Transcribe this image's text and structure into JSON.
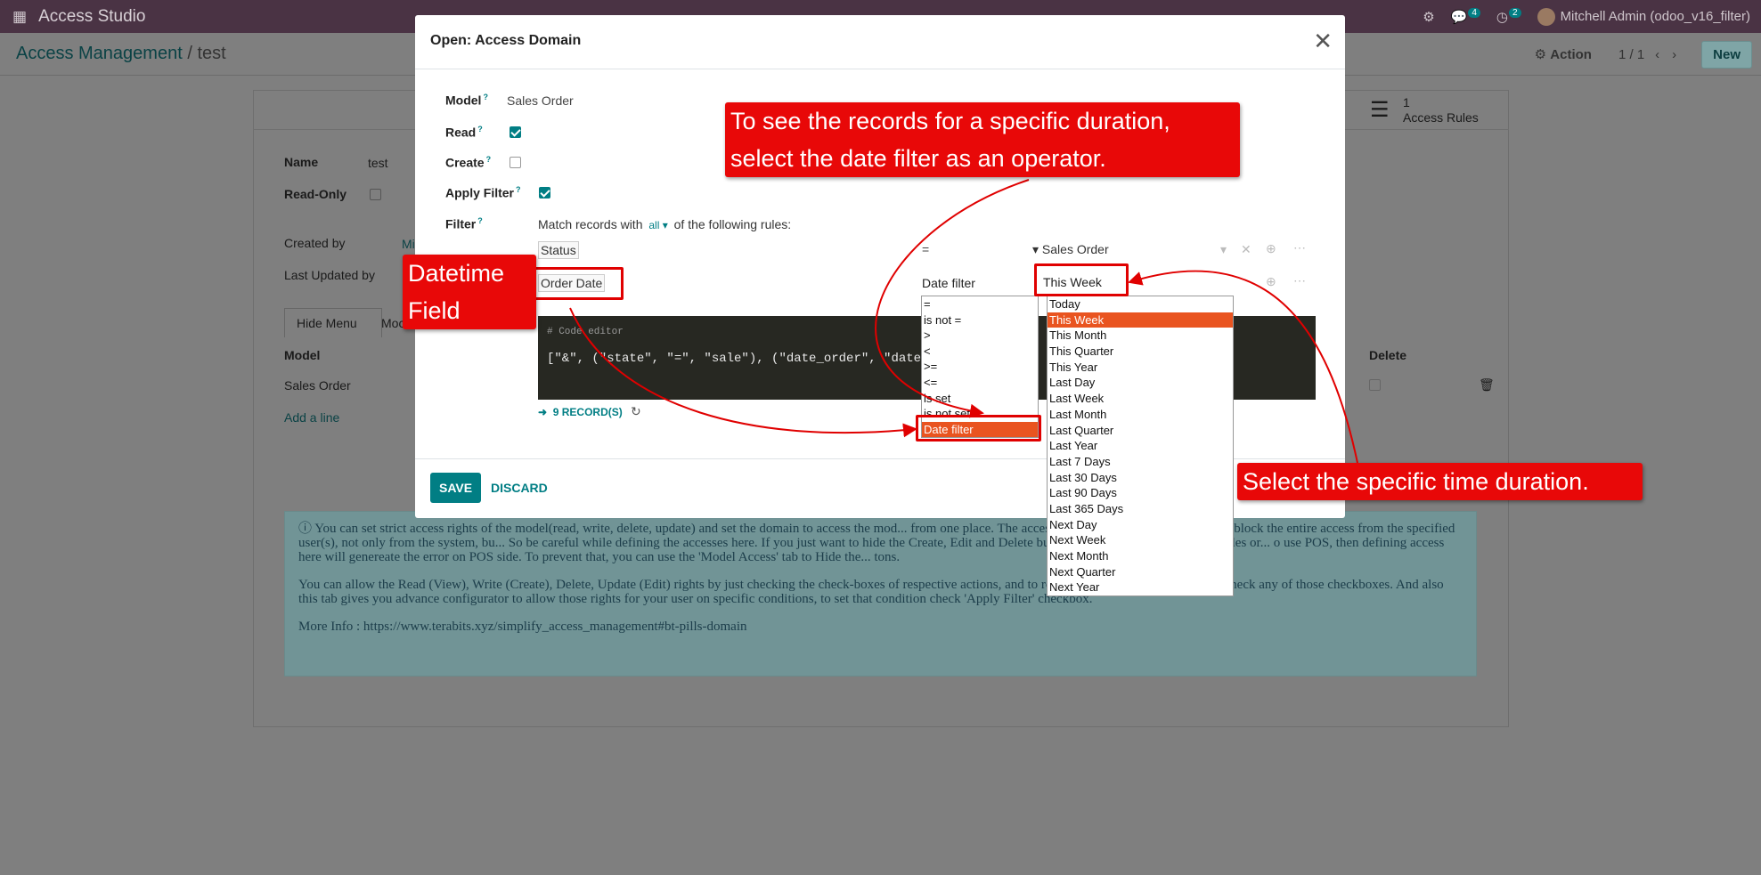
{
  "topbar": {
    "app_name": "Access Studio",
    "chat_count": "4",
    "activity_count": "2",
    "user": "Mitchell Admin (odoo_v16_filter)"
  },
  "breadcrumb": {
    "parent": "Access Management",
    "separator": "/",
    "current": "test"
  },
  "control_panel": {
    "action": "Action",
    "pager": "1 / 1",
    "new": "New"
  },
  "background_form": {
    "smart_button": {
      "count": "1",
      "label": "Access Rules"
    },
    "name_label": "Name",
    "name_value": "test",
    "readonly_label": "Read-Only",
    "created_by_label": "Created by",
    "created_by_value": "Mi",
    "last_updated_label": "Last Updated by",
    "tabs": [
      "Hide Menu",
      "Moc"
    ],
    "table_header": {
      "model": "Model",
      "delete": "Delete"
    },
    "table_row": "Sales Order",
    "add_line": "Add a line"
  },
  "info": {
    "p1": "You can set strict access rights of the model(read, write, delete, update) and set the domain to access the mod... from one place. The access defined here will either allow or block the entire access from the specified user(s), not only from the system, bu... So be careful while defining the accesses here. If you just want to hide the Create, Edit and Delete buttons from the backend user for sales or... o use POS, then defining access here will genereate the error on POS side. To prevent that, you can use the 'Model Access' tab to Hide the... tons.",
    "p2": "You can allow the Read (View), Write (Create), Delete, Update (Edit) rights by just checking the check-boxes of respective actions, and to restrict them of those rights, don't check any of those checkboxes. And also this tab gives you advance configurator to allow those rights for your user on specific conditions, to set that condition check 'Apply Filter' checkbox.",
    "p3": "More Info : https://www.terabits.xyz/simplify_access_management#bt-pills-domain"
  },
  "modal": {
    "title": "Open: Access Domain",
    "model_label": "Model",
    "model_value": "Sales Order",
    "read_label": "Read",
    "create_label": "Create",
    "apply_filter_label": "Apply Filter",
    "filter_label": "Filter",
    "match_prefix": "Match records with",
    "match_mode": "all",
    "match_suffix": "of the following rules:",
    "rule1": {
      "field": "Status",
      "operator": "=",
      "value": "Sales Order"
    },
    "rule2": {
      "field": "Order Date",
      "operator": "Date filter",
      "value": "This Week"
    },
    "code_comment": "# Code editor",
    "code": "[\"&\", (\"state\", \"=\", \"sale\"), (\"date_order\", \"date",
    "records": "9 RECORD(S)",
    "save": "SAVE",
    "discard": "DISCARD"
  },
  "operator_options": [
    "=",
    "is not =",
    ">",
    "<",
    ">=",
    "<=",
    "is set",
    "is not set",
    "Date filter"
  ],
  "date_options": [
    "Today",
    "This Week",
    "This Month",
    "This Quarter",
    "This Year",
    "Last Day",
    "Last Week",
    "Last Month",
    "Last Quarter",
    "Last Year",
    "Last 7 Days",
    "Last 30 Days",
    "Last 90 Days",
    "Last 365 Days",
    "Next Day",
    "Next Week",
    "Next Month",
    "Next Quarter",
    "Next Year"
  ],
  "callouts": {
    "top_line1": "To see the records for a specific duration,",
    "top_line2": "select the date filter as an operator.",
    "field_line1": "Datetime",
    "field_line2": "Field",
    "right": "Select the specific time duration."
  },
  "colors": {
    "primary": "#017e84",
    "highlight": "#e95420",
    "callout": "#e80808",
    "topbar": "#4a3344"
  }
}
